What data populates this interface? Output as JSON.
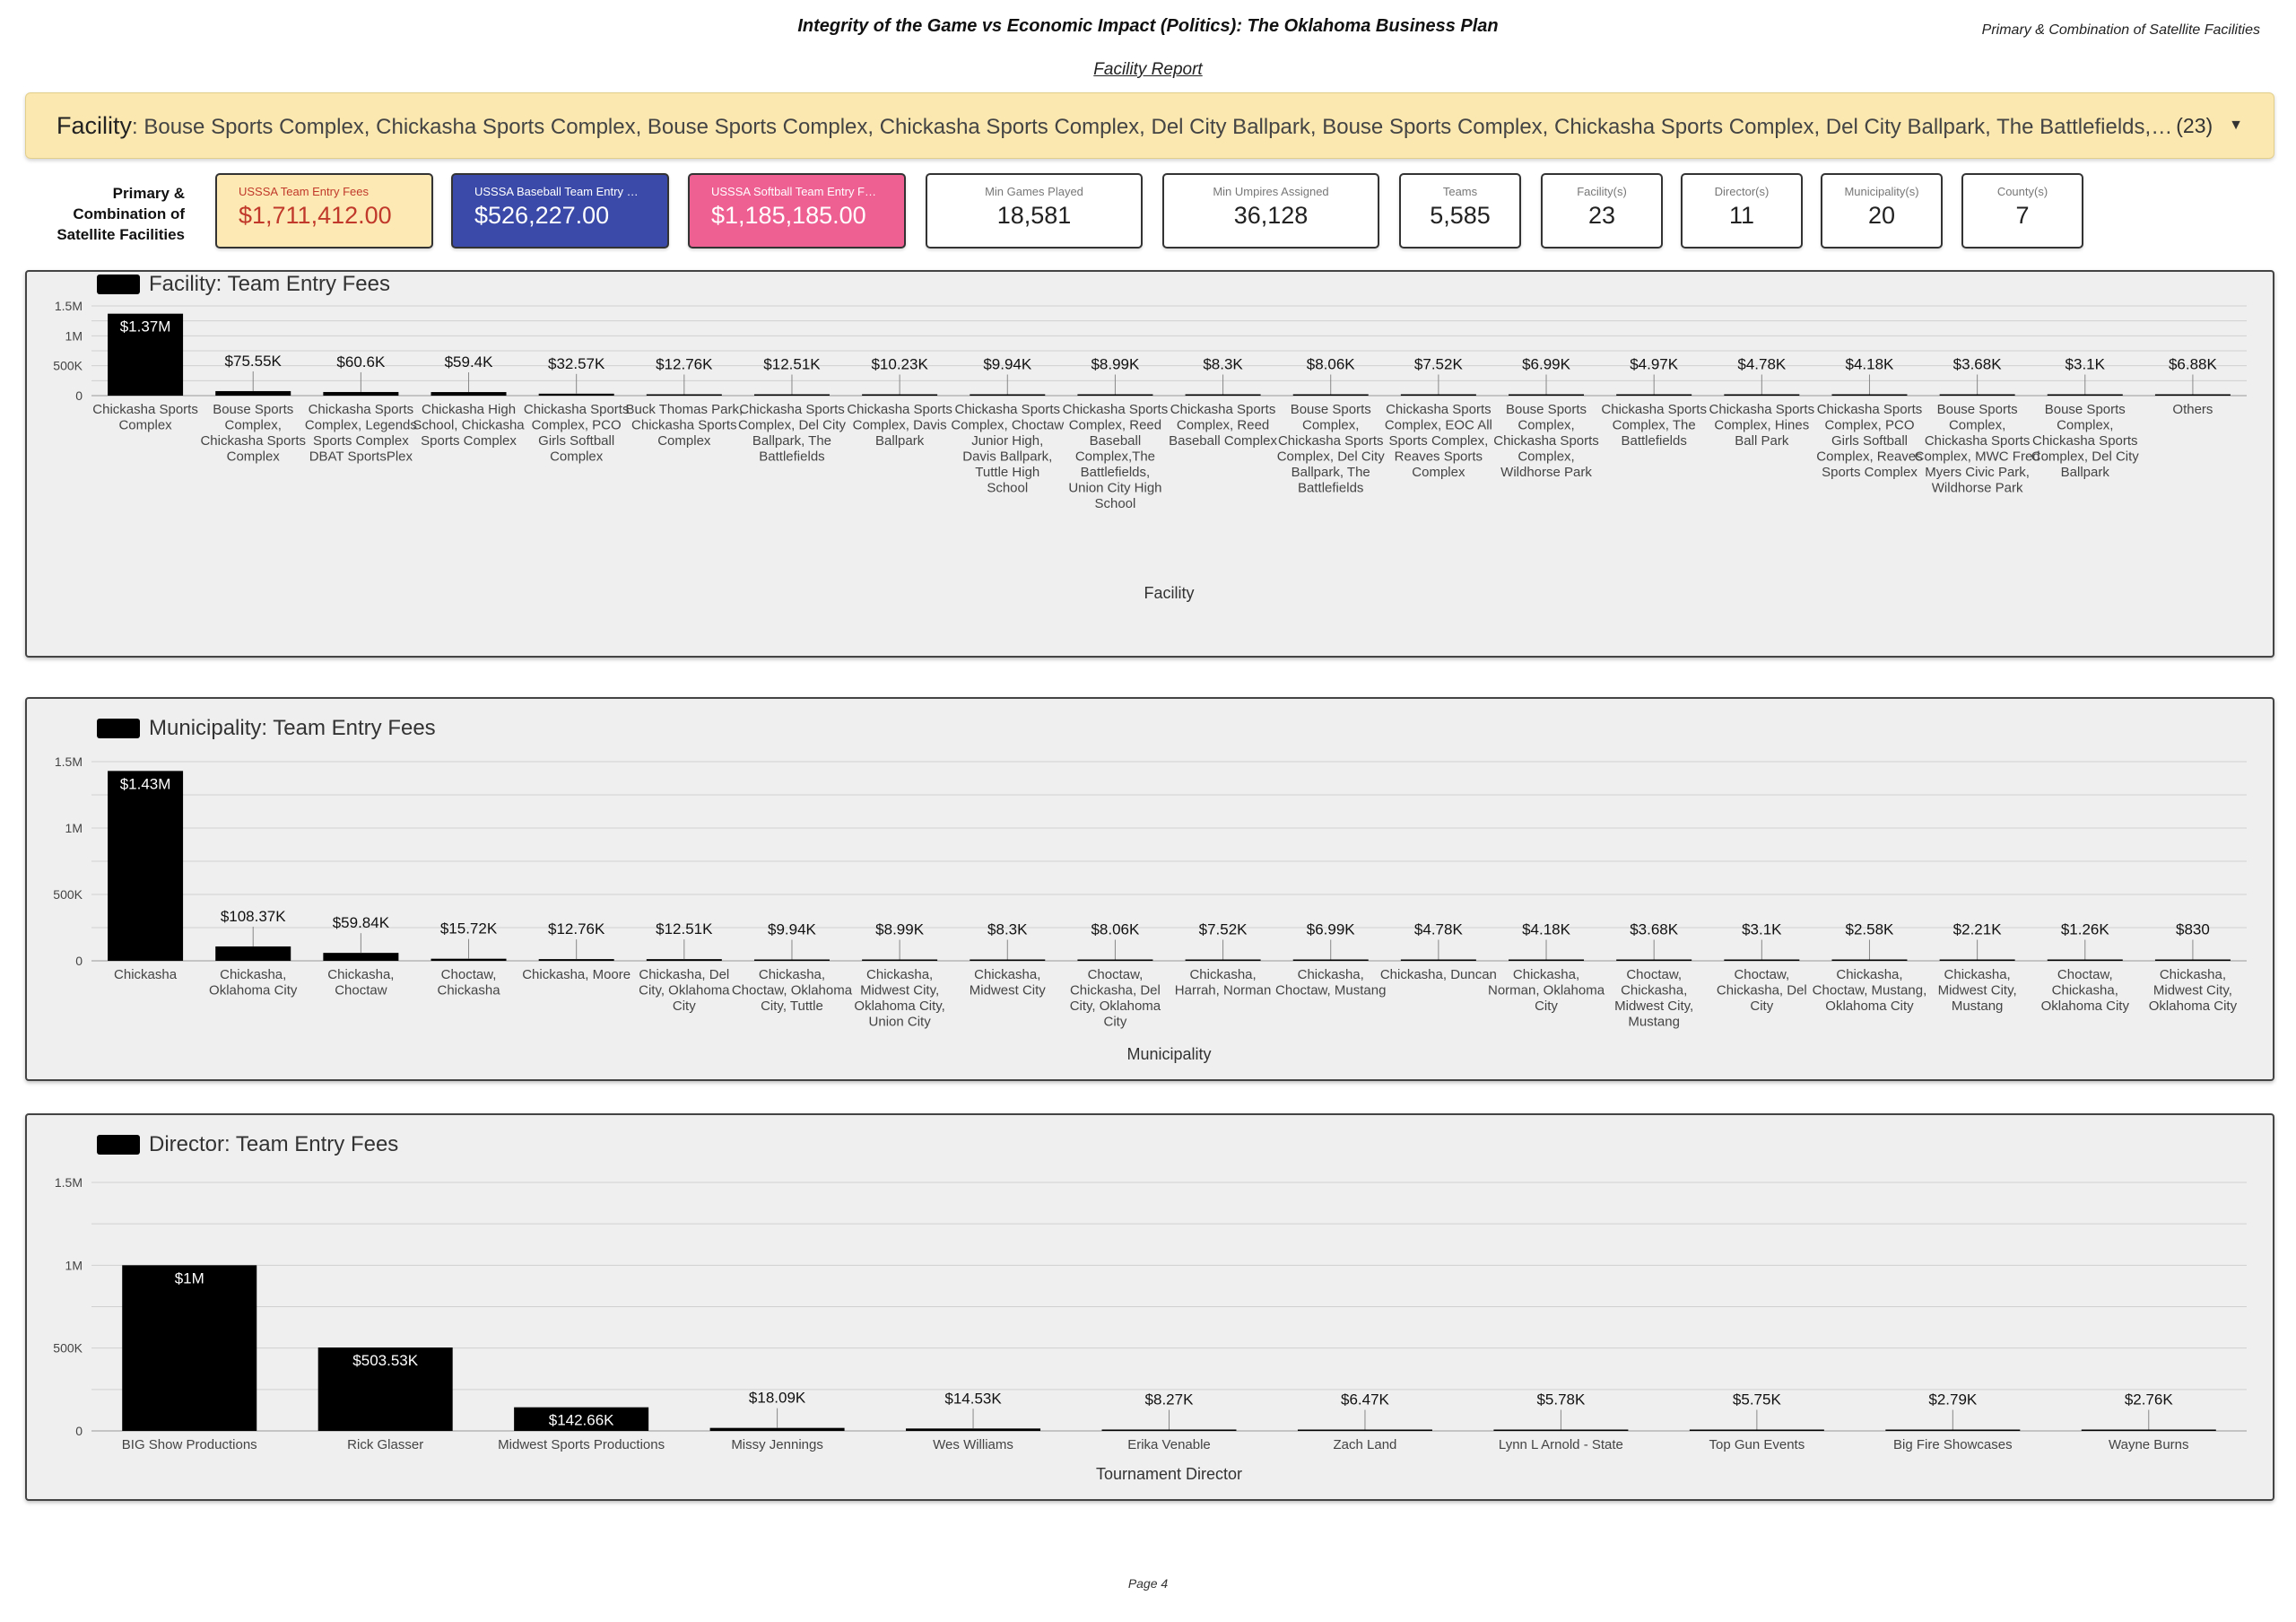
{
  "header": {
    "title": "Integrity of the Game vs Economic Impact (Politics): The Oklahoma Business Plan",
    "right_label": "Primary & Combination of Satellite Facilities",
    "subtitle": "Facility Report"
  },
  "filter": {
    "label": "Facility",
    "values": ": Bouse Sports Complex, Chickasha Sports Complex, Bouse Sports Complex, Chickasha Sports Complex, Del City Ballpark, Bouse Sports Complex, Chickasha Sports Complex, Del City Ballpark, The Battlefields, Chickasha Sports Complex, Del City Ballpark",
    "count": "(23)",
    "caret": "▼"
  },
  "kpi_side_label": "Primary & Combination of Satellite Facilities",
  "kpis": [
    {
      "label": "USSSA Team Entry Fees",
      "value": "$1,711,412.00",
      "bg": "#fde9b3",
      "label_color": "#c0392b",
      "value_color": "#c0392b"
    },
    {
      "label": "USSSA Baseball Team Entry …",
      "value": "$526,227.00",
      "bg": "#3b4aa8",
      "label_color": "#ffffff",
      "value_color": "#ffffff"
    },
    {
      "label": "USSSA Softball Team Entry F…",
      "value": "$1,185,185.00",
      "bg": "#ee5f92",
      "label_color": "#ffffff",
      "value_color": "#ffffff"
    },
    {
      "label": "Min Games Played",
      "value": "18,581"
    },
    {
      "label": "Min Umpires Assigned",
      "value": "36,128"
    },
    {
      "label": "Teams",
      "value": "5,585"
    },
    {
      "label": "Facility(s)",
      "value": "23"
    },
    {
      "label": "Director(s)",
      "value": "11"
    },
    {
      "label": "Municipality(s)",
      "value": "20"
    },
    {
      "label": "County(s)",
      "value": "7"
    }
  ],
  "colors": {
    "bar": "#000000",
    "grid": "#d0d0d0",
    "panel_bg": "#efefef"
  },
  "chart_data": [
    {
      "type": "bar",
      "title": "Facility: Team Entry Fees",
      "xlabel": "Facility",
      "ylabel": "",
      "ylim": [
        0,
        1500000
      ],
      "yticks": [
        0,
        500000,
        1000000,
        1500000
      ],
      "ytick_labels": [
        "0",
        "500K",
        "1M",
        "1.5M"
      ],
      "grid": true,
      "categories": [
        "Chickasha Sports Complex",
        "Bouse Sports Complex, Chickasha Sports Complex",
        "Chickasha Sports Complex, Legends Sports Complex DBAT SportsPlex",
        "Chickasha High School, Chickasha Sports Complex",
        "Chickasha Sports Complex, PCO Girls Softball Complex",
        "Buck Thomas Park, Chickasha Sports Complex",
        "Chickasha Sports Complex, Del City Ballpark, The Battlefields",
        "Chickasha Sports Complex, Davis Ballpark",
        "Chickasha Sports Complex, Choctaw Junior High, Davis Ballpark, Tuttle High School",
        "Chickasha Sports Complex, Reed Baseball Complex,The Battlefields, Union City High School",
        "Chickasha Sports Complex, Reed Baseball Complex",
        "Bouse Sports Complex, Chickasha Sports Complex, Del City Ballpark, The Battlefields",
        "Chickasha Sports Complex, EOC All Sports Complex, Reaves Sports Complex",
        "Bouse Sports Complex, Chickasha Sports Complex, Wildhorse Park",
        "Chickasha Sports Complex, The Battlefields",
        "Chickasha Sports Complex, Hines Ball Park",
        "Chickasha Sports Complex, PCO Girls Softball Complex, Reaves Sports Complex",
        "Bouse Sports Complex, Chickasha Sports Complex, MWC Fred Myers Civic Park, Wildhorse Park",
        "Bouse Sports Complex, Chickasha Sports Complex, Del City Ballpark",
        "Others"
      ],
      "values": [
        1370000,
        75550,
        60600,
        59400,
        32570,
        12760,
        12510,
        10230,
        9940,
        8990,
        8300,
        8060,
        7520,
        6990,
        4970,
        4780,
        4180,
        3680,
        3100,
        6880
      ],
      "labels": [
        "$1.37M",
        "$75.55K",
        "$60.6K",
        "$59.4K",
        "$32.57K",
        "$12.76K",
        "$12.51K",
        "$10.23K",
        "$9.94K",
        "$8.99K",
        "$8.3K",
        "$8.06K",
        "$7.52K",
        "$6.99K",
        "$4.97K",
        "$4.78K",
        "$4.18K",
        "$3.68K",
        "$3.1K",
        "$6.88K"
      ]
    },
    {
      "type": "bar",
      "title": "Municipality: Team Entry Fees",
      "xlabel": "Municipality",
      "ylabel": "",
      "ylim": [
        0,
        1500000
      ],
      "yticks": [
        0,
        500000,
        1000000,
        1500000
      ],
      "ytick_labels": [
        "0",
        "500K",
        "1M",
        "1.5M"
      ],
      "grid": true,
      "categories": [
        "Chickasha",
        "Chickasha, Oklahoma City",
        "Chickasha, Choctaw",
        "Choctaw, Chickasha",
        "Chickasha, Moore",
        "Chickasha, Del City, Oklahoma City",
        "Chickasha, Choctaw, Oklahoma City, Tuttle",
        "Chickasha, Midwest City, Oklahoma City, Union City",
        "Chickasha, Midwest City",
        "Choctaw, Chickasha, Del City, Oklahoma City",
        "Chickasha, Harrah, Norman",
        "Chickasha, Choctaw, Mustang",
        "Chickasha, Duncan",
        "Chickasha, Norman, Oklahoma City",
        "Choctaw, Chickasha, Midwest City, Mustang",
        "Choctaw, Chickasha, Del City",
        "Chickasha, Choctaw, Mustang, Oklahoma City",
        "Chickasha, Midwest City, Mustang",
        "Choctaw, Chickasha, Oklahoma City",
        "Chickasha, Midwest City, Oklahoma City"
      ],
      "values": [
        1430000,
        108370,
        59840,
        15720,
        12760,
        12510,
        9940,
        8990,
        8300,
        8060,
        7520,
        6990,
        4780,
        4180,
        3680,
        3100,
        2580,
        2210,
        1260,
        830
      ],
      "labels": [
        "$1.43M",
        "$108.37K",
        "$59.84K",
        "$15.72K",
        "$12.76K",
        "$12.51K",
        "$9.94K",
        "$8.99K",
        "$8.3K",
        "$8.06K",
        "$7.52K",
        "$6.99K",
        "$4.78K",
        "$4.18K",
        "$3.68K",
        "$3.1K",
        "$2.58K",
        "$2.21K",
        "$1.26K",
        "$830"
      ]
    },
    {
      "type": "bar",
      "title": "Director: Team Entry Fees",
      "xlabel": "Tournament Director",
      "ylabel": "",
      "ylim": [
        0,
        1500000
      ],
      "yticks": [
        0,
        500000,
        1000000,
        1500000
      ],
      "ytick_labels": [
        "0",
        "500K",
        "1M",
        "1.5M"
      ],
      "grid": true,
      "categories": [
        "BIG Show Productions",
        "Rick Glasser",
        "Midwest Sports Productions",
        "Missy Jennings",
        "Wes Williams",
        "Erika Venable",
        "Zach Land",
        "Lynn L Arnold - State",
        "Top Gun Events",
        "Big Fire Showcases",
        "Wayne Burns"
      ],
      "values": [
        1000000,
        503530,
        142660,
        18090,
        14530,
        8270,
        6470,
        5780,
        5750,
        2790,
        2760
      ],
      "labels": [
        "$1M",
        "$503.53K",
        "$142.66K",
        "$18.09K",
        "$14.53K",
        "$8.27K",
        "$6.47K",
        "$5.78K",
        "$5.75K",
        "$2.79K",
        "$2.76K"
      ]
    }
  ],
  "footer": {
    "page": "Page 4"
  }
}
